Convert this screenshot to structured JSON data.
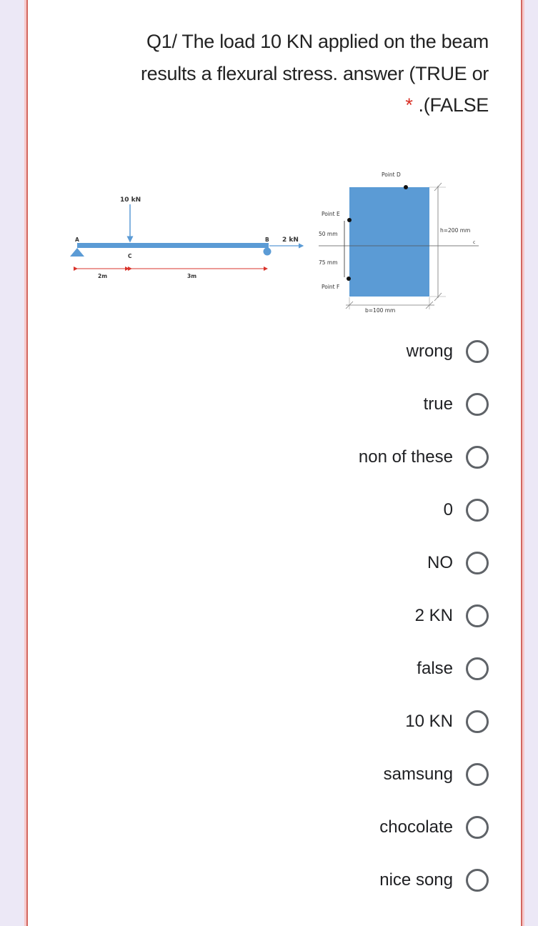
{
  "question": {
    "line1": "Q1/ The load 10 KN applied on the beam",
    "line2": "results a flexural stress. answer (TRUE or",
    "required_marker": "*",
    "line3": ".(FALSE"
  },
  "figure": {
    "beam": {
      "support_a_label": "A",
      "support_b_label": "B",
      "point_c_label": "C",
      "load_c_label": "10 kN",
      "load_b_label": "2 kN",
      "span_ac_label": "2m",
      "span_cb_label": "3m"
    },
    "section": {
      "point_d_label": "Point D",
      "point_e_label": "Point E",
      "point_f_label": "Point F",
      "dim_e_label": "50 mm",
      "dim_f_label": "75 mm",
      "height_label": "h=200 mm",
      "width_label": "b=100 mm",
      "centroid_label": "c"
    },
    "colors": {
      "beam_blue": "#5b9bd5",
      "dimension_red": "#d9332b"
    }
  },
  "options": [
    {
      "label": "wrong",
      "selected": false
    },
    {
      "label": "true",
      "selected": false
    },
    {
      "label": "non of these",
      "selected": false
    },
    {
      "label": "0",
      "selected": false
    },
    {
      "label": "NO",
      "selected": false
    },
    {
      "label": "2 KN",
      "selected": false
    },
    {
      "label": "false",
      "selected": false
    },
    {
      "label": "10 KN",
      "selected": false
    },
    {
      "label": "samsung",
      "selected": false
    },
    {
      "label": "chocolate",
      "selected": false
    },
    {
      "label": "nice song",
      "selected": false
    }
  ]
}
